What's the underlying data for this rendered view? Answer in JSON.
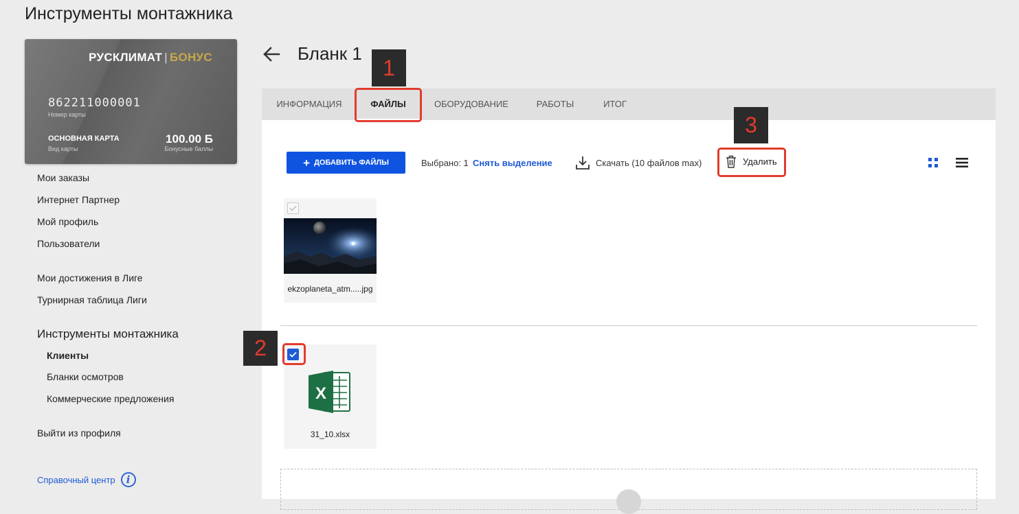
{
  "page": {
    "title": "Инструменты монтажника"
  },
  "card": {
    "brand_main": "РУСКЛИМАТ",
    "brand_sep": "|",
    "brand_bonus": "БОНУС",
    "number": "862211000001",
    "number_label": "Номер карты",
    "type": "ОСНОВНАЯ КАРТА",
    "type_label": "Вид карты",
    "points": "100.00 Б",
    "points_label": "Бонусные баллы"
  },
  "menu": {
    "items": [
      "Мои заказы",
      "Интернет Партнер",
      "Мой профиль",
      "Пользователи"
    ],
    "league": [
      "Мои достижения в Лиге",
      "Турнирная таблица Лиги"
    ],
    "section_title": "Инструменты монтажника",
    "sub_items": [
      "Клиенты",
      "Бланки осмотров",
      "Коммерческие предложения"
    ],
    "logout": "Выйти из профиля",
    "help": "Справочный центр",
    "help_icon_glyph": "i"
  },
  "header": {
    "title": "Бланк 1"
  },
  "tabs": [
    "Информация",
    "Файлы",
    "Оборудование",
    "Работы",
    "Итог"
  ],
  "active_tab": "Файлы",
  "toolbar": {
    "add_label": "Добавить файлы",
    "add_icon": "+",
    "selected_text": "Выбрано: 1",
    "clear_label": "Снять выделение",
    "download_label": "Скачать (10 файлов max)",
    "delete_label": "Удалить"
  },
  "files": [
    {
      "name": "ekzoplaneta_atm.....jpg",
      "type": "image",
      "selected": false
    },
    {
      "name": "31_10.xlsx",
      "type": "excel",
      "selected": true,
      "icon_letter": "X"
    }
  ],
  "annotations": [
    "1",
    "2",
    "3"
  ],
  "colors": {
    "primary": "#0f54e0",
    "link": "#1e5bd6",
    "highlight": "#e23b2e",
    "excel": "#1d7044",
    "bonus_gold": "#c9a84c"
  }
}
